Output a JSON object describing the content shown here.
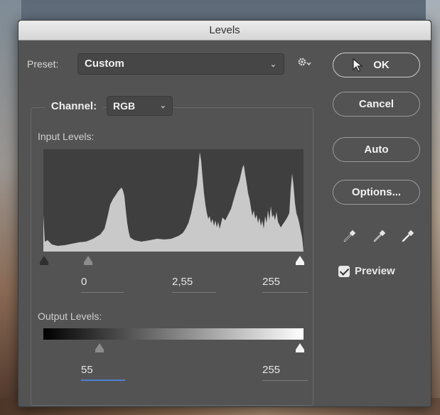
{
  "dialog": {
    "title": "Levels"
  },
  "preset": {
    "label": "Preset:",
    "value": "Custom"
  },
  "channel": {
    "label": "Channel:",
    "value": "RGB"
  },
  "input_levels": {
    "label": "Input Levels:",
    "black": "0",
    "gamma": "2,55",
    "white": "255"
  },
  "output_levels": {
    "label": "Output Levels:",
    "black": "55",
    "white": "255"
  },
  "buttons": {
    "ok": "OK",
    "cancel": "Cancel",
    "auto": "Auto",
    "options": "Options..."
  },
  "preview": {
    "label": "Preview",
    "checked": true
  },
  "icons": {
    "gear": "gear-icon",
    "black_eyedropper": "eyedropper-black-icon",
    "gray_eyedropper": "eyedropper-gray-icon",
    "white_eyedropper": "eyedropper-white-icon",
    "cursor": "mouse-pointer-icon"
  },
  "colors": {
    "dialog_bg": "#535353",
    "histogram_fill": "#c8c8c8",
    "active_field_underline": "#4f7fd0"
  }
}
